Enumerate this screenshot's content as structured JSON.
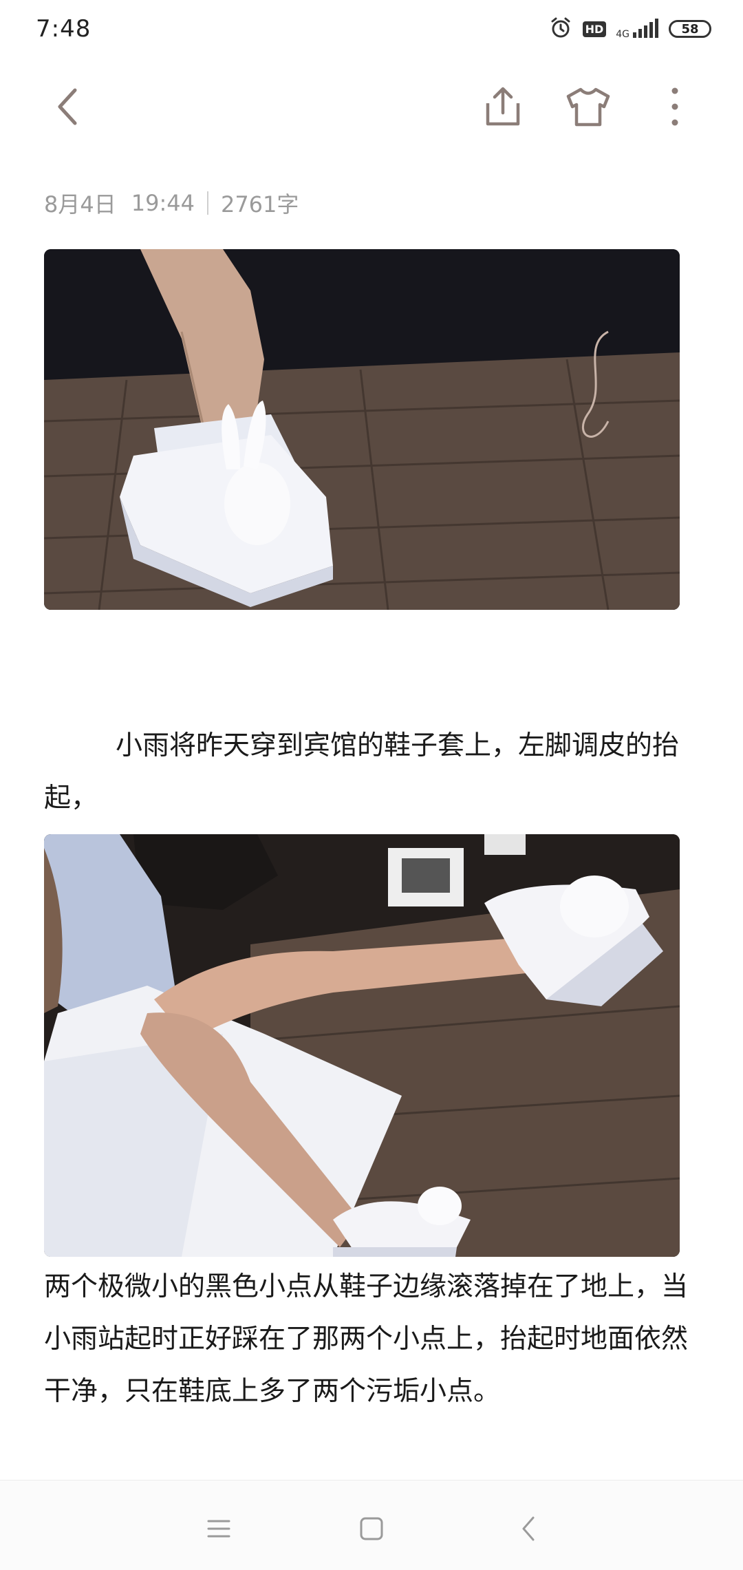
{
  "status": {
    "time": "7:48",
    "hd": "HD",
    "network": "4G",
    "battery": "58"
  },
  "meta": {
    "date": "8月4日",
    "time": "19:44",
    "word_count": "2761字"
  },
  "content": {
    "paragraph_1": "小雨将昨天穿到宾馆的鞋子套上，左脚调皮的抬起，",
    "paragraph_2": "两个极微小的黑色小点从鞋子边缘滚落掉在了地上，当小雨站起时正好踩在了那两个小点上，抬起时地面依然干净，只在鞋底上多了两个污垢小点。"
  },
  "colors": {
    "accent_icon": "#8b7d78",
    "meta_text": "#9a9a9a",
    "body_text": "#1a1a1a"
  },
  "icons": {
    "back": "chevron-left-icon",
    "share": "share-icon",
    "theme": "tshirt-icon",
    "more": "more-vertical-icon"
  }
}
